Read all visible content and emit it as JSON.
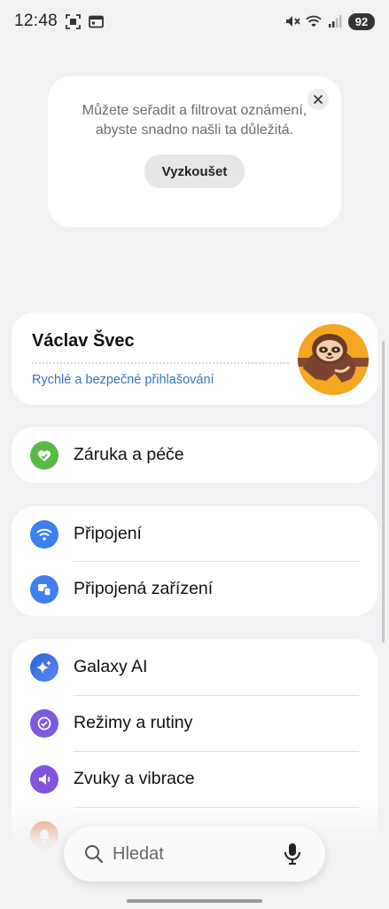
{
  "status_bar": {
    "time": "12:48",
    "battery": "92",
    "icons": [
      "screenshot-icon",
      "calendar-icon",
      "mute-icon",
      "wifi-icon",
      "signal-icon"
    ]
  },
  "tip": {
    "text": "Můžete seřadit a filtrovat oznámení, abyste snadno našli ta důležitá.",
    "button_label": "Vyzkoušet",
    "close_icon": "close-icon"
  },
  "account": {
    "name": "Václav Švec",
    "subtitle": "Rychlé a bezpečné přihlašování",
    "avatar": "sloth-avatar"
  },
  "groups": [
    {
      "items": [
        {
          "label": "Záruka a péče",
          "icon": "care-heart-icon",
          "color": "#59b946"
        }
      ]
    },
    {
      "items": [
        {
          "label": "Připojení",
          "icon": "wifi-icon",
          "color": "#3d7ff0"
        },
        {
          "label": "Připojená zařízení",
          "icon": "devices-icon",
          "color": "#3d7ff0"
        }
      ]
    },
    {
      "items": [
        {
          "label": "Galaxy AI",
          "icon": "sparkle-icon",
          "color": "#3466e0"
        },
        {
          "label": "Režimy a rutiny",
          "icon": "check-circle-icon",
          "color": "#7b5ae0"
        },
        {
          "label": "Zvuky a vibrace",
          "icon": "speaker-icon",
          "color": "#8154e0"
        },
        {
          "label": "",
          "icon": "bell-icon",
          "color": "#ef7f4a"
        }
      ]
    }
  ],
  "search": {
    "placeholder": "Hledat"
  }
}
